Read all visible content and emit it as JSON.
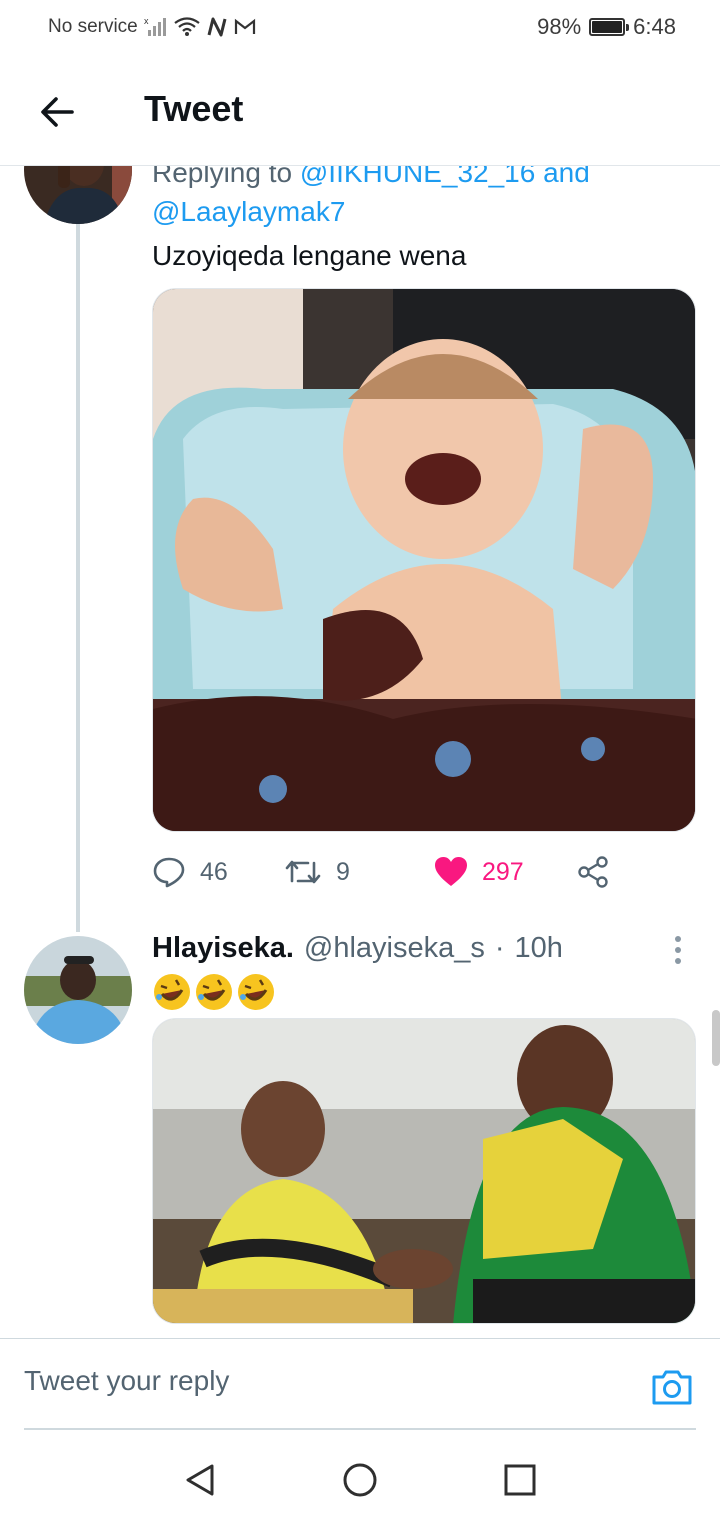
{
  "status_bar": {
    "carrier": "No service",
    "battery_percent": "98%",
    "battery_level": 0.98,
    "time": "6:48",
    "icons": [
      "signal-off-icon",
      "wifi-icon",
      "nfc-icon",
      "gmail-icon",
      "battery-icon"
    ]
  },
  "header": {
    "title": "Tweet",
    "back_icon": "arrow-left-icon"
  },
  "tweet_1": {
    "replying_label": "Replying to ",
    "reply_handle_1": "@IIKHUNE_32_16",
    "reply_and": " and",
    "reply_handle_2": "@Laaylaymak7",
    "text": "Uzoyiqeda lengane wena",
    "media_alt": "baby covered in chocolate cake",
    "actions": {
      "replies": "46",
      "retweets": "9",
      "likes": "297",
      "liked": true
    },
    "colors": {
      "like": "#f91880",
      "link": "#1d9bf0"
    }
  },
  "tweet_2": {
    "name": "Hlayiseka.",
    "handle": "@hlayiseka_s",
    "separator": "·",
    "time": "10h",
    "emojis": [
      "rolling-on-floor-laughing",
      "rolling-on-floor-laughing",
      "rolling-on-floor-laughing"
    ],
    "media_alt": "two men laughing and shaking hands"
  },
  "composer": {
    "placeholder": "Tweet your reply",
    "camera_icon": "camera-icon"
  },
  "nav_bar": {
    "icons": [
      "back-triangle-icon",
      "home-circle-icon",
      "recents-square-icon"
    ]
  }
}
